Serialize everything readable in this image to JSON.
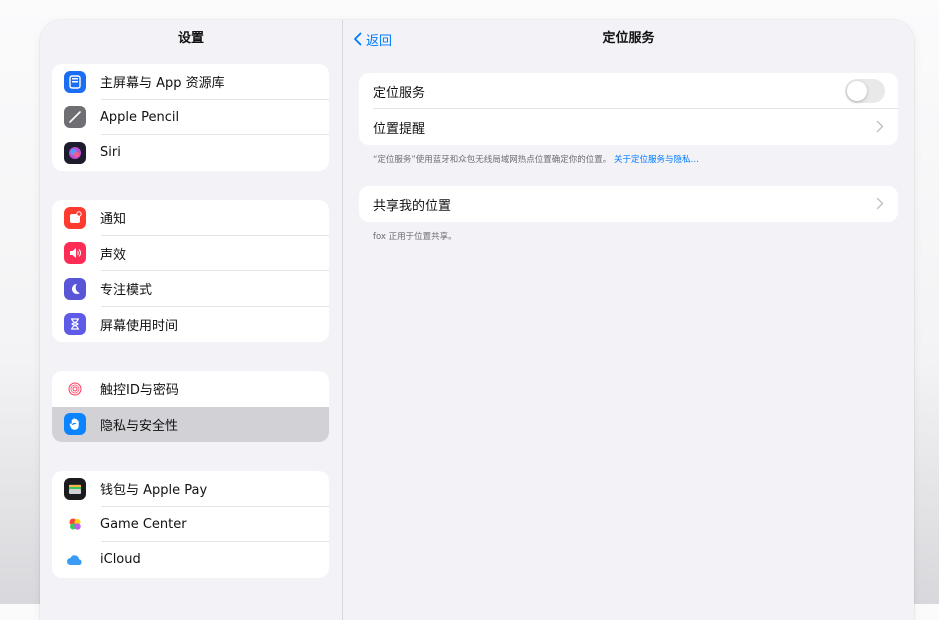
{
  "sidebar": {
    "title": "设置",
    "group1": [
      {
        "label": "主屏幕与 App 资源库",
        "icon": "home-screen-icon",
        "color": "#1b6ef3"
      },
      {
        "label": "Apple Pencil",
        "icon": "pencil-icon",
        "color": "#6e6e73"
      },
      {
        "label": "Siri",
        "icon": "siri-icon",
        "color": "#2b2b5e"
      }
    ],
    "group2": [
      {
        "label": "通知",
        "icon": "notifications-icon",
        "color": "#ff3b30"
      },
      {
        "label": "声效",
        "icon": "sounds-icon",
        "color": "#ff2d55"
      },
      {
        "label": "专注模式",
        "icon": "moon-icon",
        "color": "#5856d6"
      },
      {
        "label": "屏幕使用时间",
        "icon": "hourglass-icon",
        "color": "#5e5ce6"
      }
    ],
    "group3": [
      {
        "label": "触控ID与密码",
        "icon": "fingerprint-icon",
        "color": "#ff375f"
      },
      {
        "label": "隐私与安全性",
        "icon": "hand-icon",
        "color": "#0a84ff",
        "selected": true
      }
    ],
    "group4": [
      {
        "label": "钱包与 Apple Pay",
        "icon": "wallet-icon",
        "color": "#1c1c1e"
      },
      {
        "label": "Game Center",
        "icon": "game-center-icon",
        "color": "#ff9f0a"
      },
      {
        "label": "iCloud",
        "icon": "cloud-icon",
        "color": "#3a9bf5"
      }
    ]
  },
  "detail": {
    "back_label": "返回",
    "title": "定位服务",
    "location_services_label": "定位服务",
    "location_services_on": false,
    "location_alerts_label": "位置提醒",
    "footer1_text": "“定位服务”使用蓝牙和众包无线局域网热点位置确定你的位置。",
    "footer1_link": "关于定位服务与隐私…",
    "share_location_label": "共享我的位置",
    "footer2_text": "fox 正用于位置共享。"
  },
  "colors": {
    "accent": "#007aff",
    "toggle_off": "#e9e9ea",
    "selected_row": "#d1d1d6"
  }
}
